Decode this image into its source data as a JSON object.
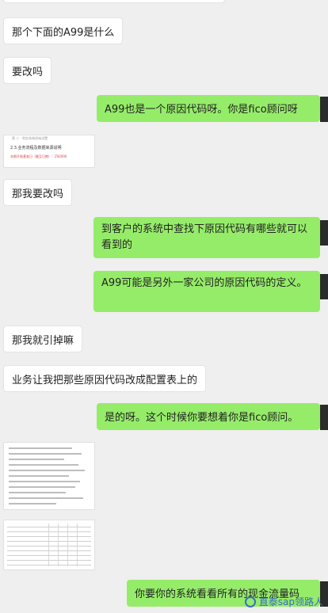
{
  "messages": [
    {
      "side": "in",
      "text": "那个下面的A99是什么"
    },
    {
      "side": "in",
      "text": "要改吗"
    },
    {
      "side": "out",
      "text": "A99也是一个原因代码呀。你是fico顾问呀"
    },
    {
      "side": "in",
      "type": "image",
      "label": "doc-screenshot"
    },
    {
      "side": "in",
      "text": "那我要改吗"
    },
    {
      "side": "out",
      "text": "到客户的系统中查找下原因代码有哪些就可以看到的"
    },
    {
      "side": "out",
      "text": "A99可能是另外一家公司的原因代码的定义。"
    },
    {
      "side": "in",
      "text": "那我就引掉嘛"
    },
    {
      "side": "in",
      "text": "业务让我把那些原因代码改成配置表上的"
    },
    {
      "side": "out",
      "text": "是的呀。这个时候你要想着你是fico顾问。"
    },
    {
      "side": "in",
      "type": "image",
      "label": "code-screenshot"
    },
    {
      "side": "in",
      "type": "image",
      "label": "sheet-screenshot"
    },
    {
      "side": "out",
      "text": "你要你的系统看看所有的现金流量码"
    }
  ],
  "thumb_doc": {
    "header": "第 二 · 财务系统初始设置",
    "section": "2.3.业务流程及数据来源说明",
    "red_note": "本期开账基准日（截至日期）：ZS0000"
  },
  "watermark": {
    "text": "直泰sap领路人",
    "icon": "wechat-icon"
  },
  "colors": {
    "out_bubble": "#95ec69",
    "in_bubble": "#ffffff",
    "background": "#efefef"
  }
}
